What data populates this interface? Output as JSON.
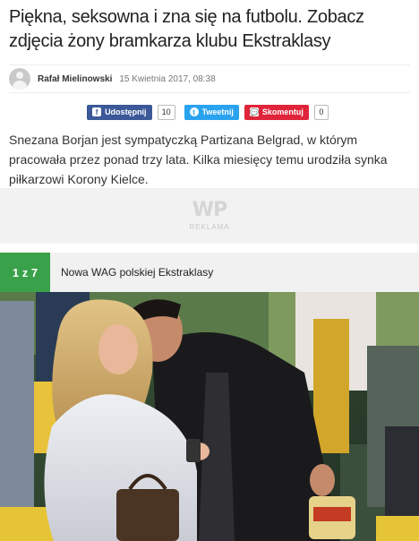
{
  "article": {
    "headline": "Piękna, seksowna i zna się na futbolu. Zobacz zdjęcia żony bramkarza klubu Ekstraklasy",
    "author": "Rafał Mielinowski",
    "date": "15 Kwietnia 2017, 08:38",
    "lead": "Snezana Borjan jest sympatyczką Partizana Belgrad, w którym pracowała przez ponad trzy lata. Kilka miesięcy temu urodziła synka piłkarzowi Korony Kielce."
  },
  "share": {
    "facebook_label": "Udostępnij",
    "facebook_count": "10",
    "twitter_label": "Tweetnij",
    "comments_label": "Skomentuj",
    "comments_count": "0",
    "facebook_icon": "f",
    "twitter_icon": "t",
    "comment_icon": "💬"
  },
  "ad": {
    "logo": "WP",
    "label": "REKLAMA"
  },
  "gallery": {
    "counter": "1 z 7",
    "title": "Nowa WAG polskiej Ekstraklasy"
  },
  "colors": {
    "facebook": "#3b5998",
    "twitter": "#2aa3ef",
    "comments": "#e0243a",
    "gallery_accent": "#39a14a"
  }
}
